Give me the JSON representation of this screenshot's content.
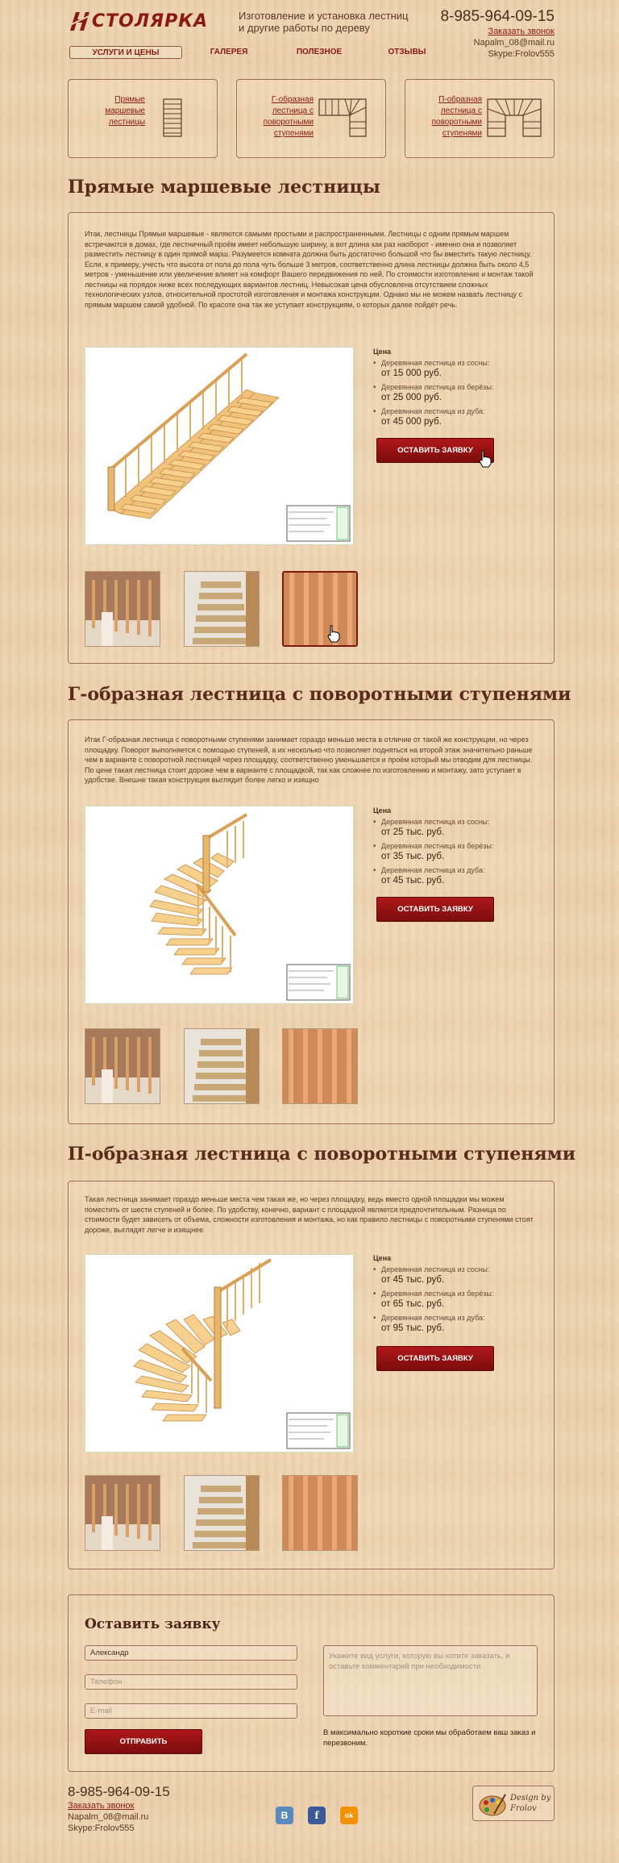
{
  "header": {
    "logo_text": "столярка",
    "tagline": "Изготовление и установка лестниц и другие работы по дереву",
    "phone": "8-985-964-09-15",
    "callback_link": "Заказать звонок",
    "email": "Napalm_08@mail.ru",
    "skype": "Skype:Frolov555"
  },
  "nav": {
    "items": [
      {
        "label": "Услуги и цены"
      },
      {
        "label": "Галерея"
      },
      {
        "label": "Полезное"
      },
      {
        "label": "Отзывы"
      }
    ]
  },
  "types": [
    {
      "label": "Прямые маршевые лестницы"
    },
    {
      "label": "Г-образная лестница с поворотными ступенями"
    },
    {
      "label": "П-образная лестница с поворотными ступенями"
    }
  ],
  "sections": [
    {
      "title": "Прямые маршевые лестницы",
      "intro": "Итак, лестницы Прямые маршевые - являются самыми простыми и распространенными. Лестницы с одним прямым маршем встречаются в домах, где лестничный проём имеет небольшую ширину, а вот длина как раз наоборот - именно она и позволяет разместить лестницу в один прямой марш. Разумеется комната должна быть достаточно большой что бы вместить такую лестницу. Если, к примеру, учесть что высота от пола до пола чуть больше 3 метров, соответственно длина лестницы должна быть около 4,5 метров - уменьшение или увеличение влияет на комфорт Вашего передвижения по ней. По стоимости изготовление и монтаж такой лестницы на порядок ниже всех последующих вариантов лестниц. Невысокая цена обусловлена отсутствием сложных технологических узлов, относительной простотой изготовления и монтажа конструкции. Однако мы не можем назвать лестницу с прямым маршем самой удобной. По красоте она так же уступает конструкциям, о которых далее пойдёт речь.",
      "price_title": "Цена",
      "prices": [
        {
          "label": "Деревянная лестница из сосны:",
          "value": "от 15 000 руб."
        },
        {
          "label": "Деревянная лестница из берёзы:",
          "value": "от 25 000 руб."
        },
        {
          "label": "Деревянная лестница из дуба:",
          "value": "от 45 000 руб."
        }
      ],
      "button": "Оставить заявку"
    },
    {
      "title": "Г-образная лестница с поворотными ступенями",
      "intro": "Итак Г-образная лестница с поворотными ступенями занимает гораздо меньше места в отличие от такой же конструкции, но через площадку. Поворот выполняется с помощью ступеней, а их несколько что позволяет подняться на второй этаж значительно раньше чем в варианте с поворотной лестницей через площадку, соответственно уменьшается и проём который мы отводим для лестницы. По цене такая лестница стоит дороже чем в варианте с площадкой, так как сложнее по изготовлению и монтажу, зато уступает в удобстве. Внешне такая конструкция выглядит более легко и изящно",
      "price_title": "Цена",
      "prices": [
        {
          "label": "Деревянная лестница из сосны:",
          "value": "от 25 тыс. руб."
        },
        {
          "label": "Деревянная лестница из берёзы:",
          "value": "от 35 тыс. руб."
        },
        {
          "label": "Деревянная лестница из дуба:",
          "value": "от 45 тыс. руб."
        }
      ],
      "button": "Оставить заявку"
    },
    {
      "title": "П-образная лестница с поворотными ступенями",
      "intro": "Такая лестница занимает гораздо меньше места чем такая же, но через площадку, ведь вместо одной площадки мы можем поместить от шести ступеней и более. По удобству, конечно, вариант с площадкой является предпочтительным. Разница по стоимости будет зависеть от объема, сложности изготовления и монтажа, но как правило лестницы с поворотными ступенями стоят дороже, выглядят легче и изящнее",
      "price_title": "Цена",
      "prices": [
        {
          "label": "Деревянная лестница из сосны:",
          "value": "от 45 тыс. руб."
        },
        {
          "label": "Деревянная лестница из берёзы:",
          "value": "от 65 тыс. руб."
        },
        {
          "label": "Деревянная лестница из дуба:",
          "value": "от 95 тыс. руб."
        }
      ],
      "button": "Оставить заявку"
    }
  ],
  "form": {
    "title": "Оставить заявку",
    "name_value": "Александр",
    "phone_placeholder": "Телефон",
    "email_placeholder": "E-mail",
    "comment_placeholder": "Укажите вид услуги, которую вы хотите заказать, и оставьте комментарий при необходимости",
    "submit": "Отправить",
    "note": "В максимально короткие сроки мы обработаем ваш заказ и перезвоним."
  },
  "footer": {
    "phone": "8-985-964-09-15",
    "callback_link": "Заказать звонок",
    "email": "Napalm_08@mail.ru",
    "skype": "Skype:Frolov555",
    "social": [
      {
        "letter": "В",
        "color": "#5b88bd"
      },
      {
        "letter": "f",
        "color": "#3b5998"
      },
      {
        "letter": "ok",
        "color": "#f39200"
      }
    ],
    "design_credit": "Design by Frolov"
  }
}
